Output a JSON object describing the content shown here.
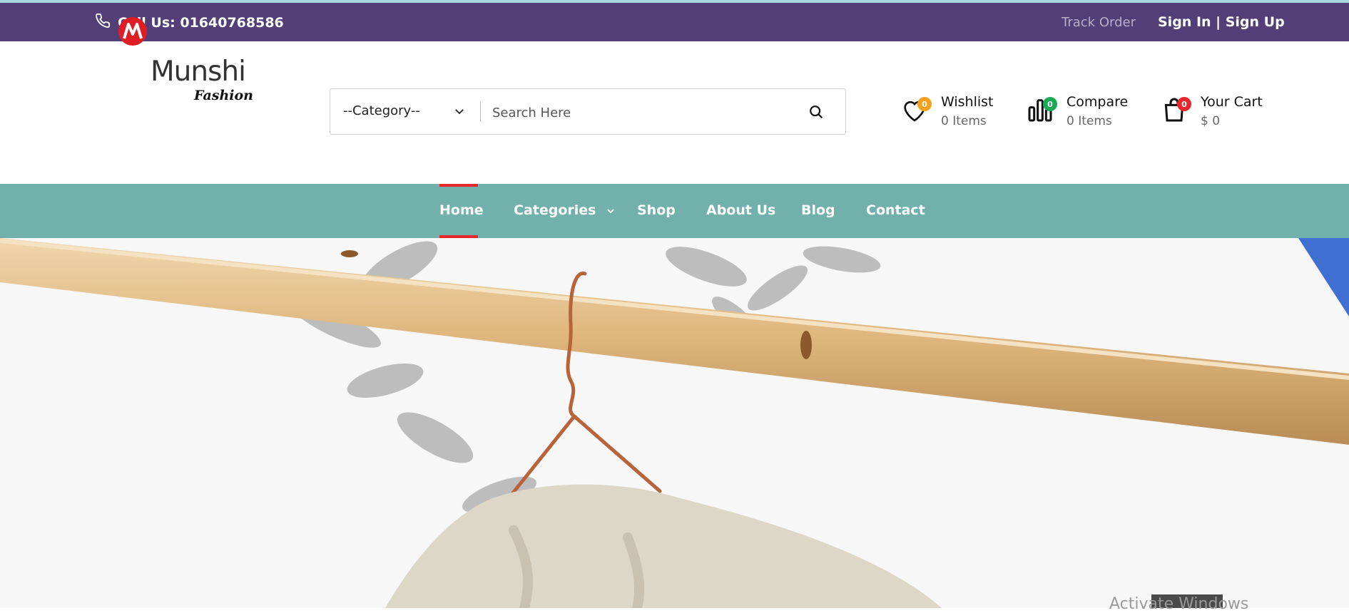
{
  "topbar": {
    "phone_text": "Call Us: 01640768586",
    "track_order": "Track Order",
    "auth": "Sign In | Sign Up"
  },
  "logo": {
    "word": "Munshi",
    "sub": "Fashion"
  },
  "search": {
    "category": "--Category--",
    "placeholder": "Search Here"
  },
  "header_items": {
    "wishlist": {
      "label": "Wishlist",
      "value": "0 Items",
      "badge": "0"
    },
    "compare": {
      "label": "Compare",
      "value": "0 Items",
      "badge": "0"
    },
    "cart": {
      "label": "Your Cart",
      "value": "$ 0",
      "badge": "0"
    }
  },
  "nav": {
    "home": "Home",
    "categories": "Categories",
    "shop": "Shop",
    "about": "About Us",
    "blog": "Blog",
    "contact": "Contact"
  },
  "watermark": "Activate Windows",
  "colors": {
    "topbar": "#523f78",
    "nav": "#72b1ab",
    "accent_red": "#e8272c",
    "wishlist_badge": "#f5a11c",
    "compare_badge": "#1aaa55",
    "cart_badge": "#e8272c"
  }
}
